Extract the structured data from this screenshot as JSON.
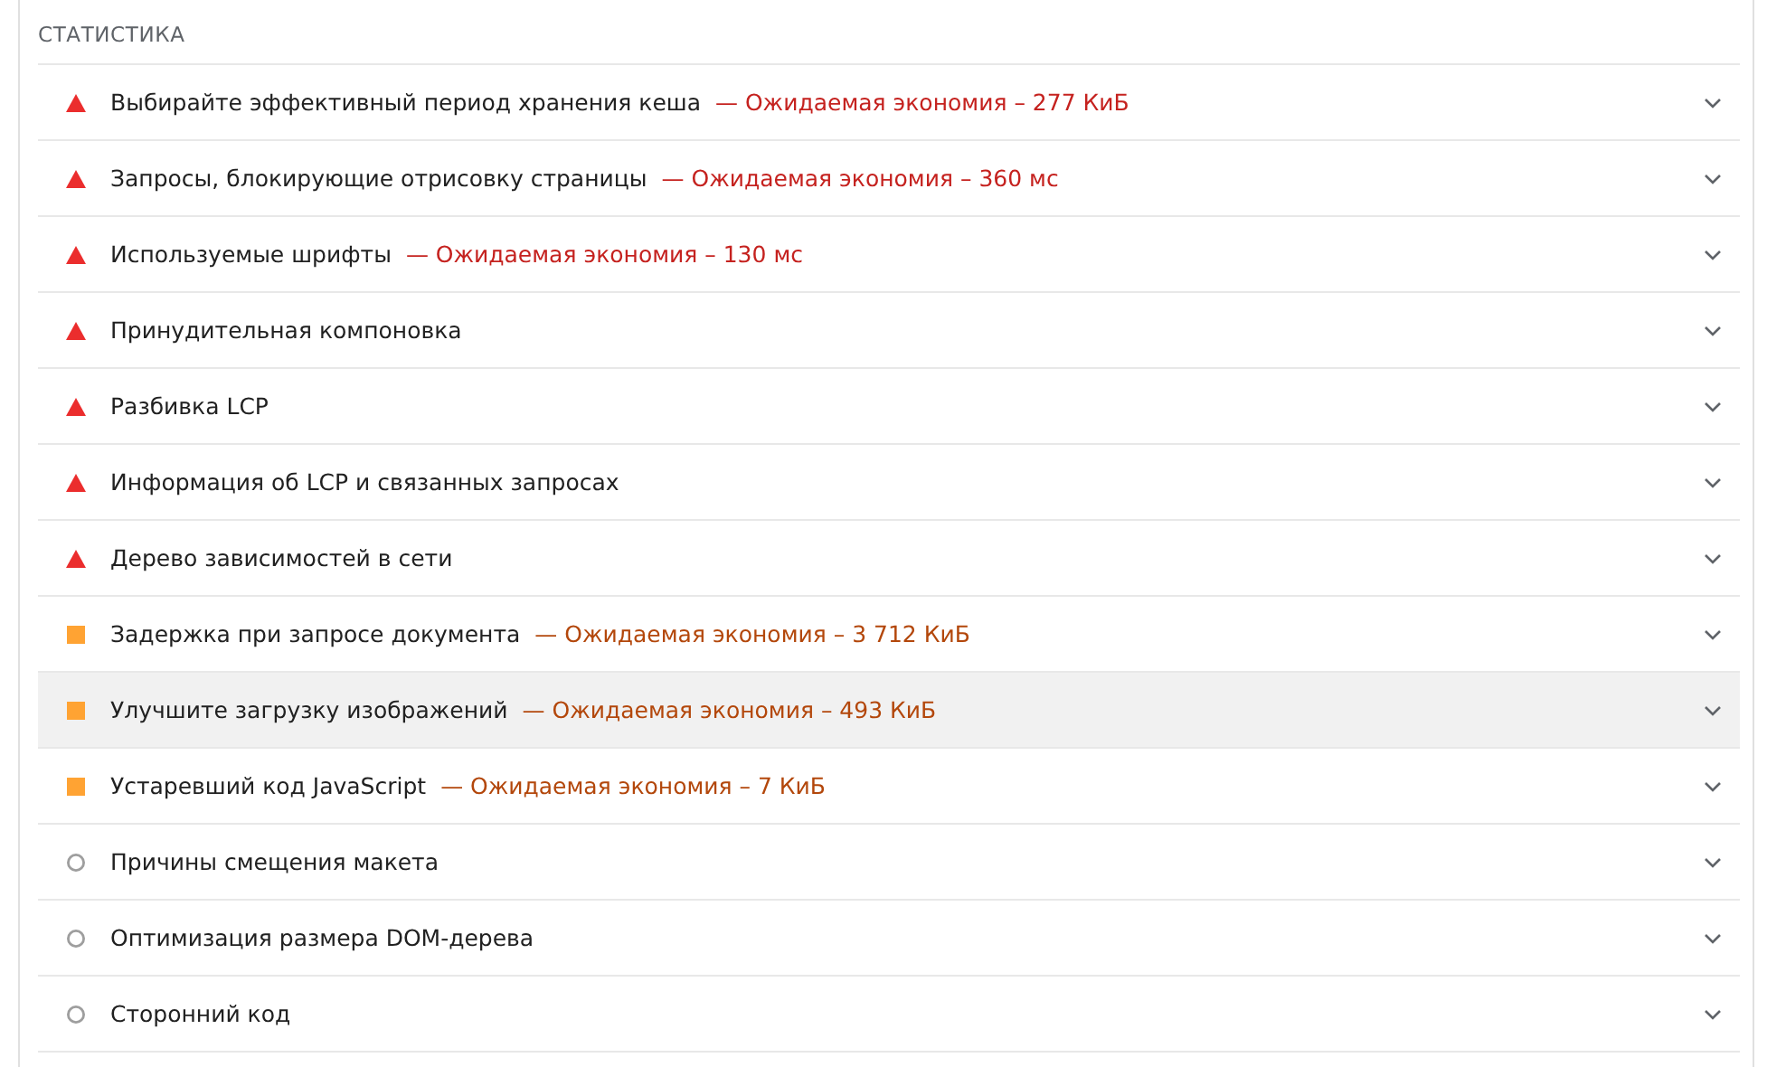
{
  "section": {
    "title": "СТАТИСТИКА"
  },
  "audits": [
    {
      "kind": "fail",
      "title": "Выбирайте эффективный период хранения кеша",
      "savings": "— Ожидаемая экономия – 277 КиБ",
      "hovered": false
    },
    {
      "kind": "fail",
      "title": "Запросы, блокирующие отрисовку страницы",
      "savings": "— Ожидаемая экономия – 360 мс",
      "hovered": false
    },
    {
      "kind": "fail",
      "title": "Используемые шрифты",
      "savings": "— Ожидаемая экономия – 130 мс",
      "hovered": false
    },
    {
      "kind": "fail",
      "title": "Принудительная компоновка",
      "hovered": false
    },
    {
      "kind": "fail",
      "title": "Разбивка LCP",
      "hovered": false
    },
    {
      "kind": "fail",
      "title": "Информация об LCP и связанных запросах",
      "hovered": false
    },
    {
      "kind": "fail",
      "title": "Дерево зависимостей в сети",
      "hovered": false
    },
    {
      "kind": "average",
      "title": "Задержка при запросе документа",
      "savings": "— Ожидаемая экономия – 3 712 КиБ",
      "hovered": false
    },
    {
      "kind": "average",
      "title": "Улучшите загрузку изображений",
      "savings": "— Ожидаемая экономия – 493 КиБ",
      "hovered": true
    },
    {
      "kind": "average",
      "title": "Устаревший код JavaScript",
      "savings": "— Ожидаемая экономия – 7 КиБ",
      "hovered": false
    },
    {
      "kind": "info",
      "title": "Причины смещения макета",
      "hovered": false
    },
    {
      "kind": "info",
      "title": "Оптимизация размера DOM-дерева",
      "hovered": false
    },
    {
      "kind": "info",
      "title": "Сторонний код",
      "hovered": false
    }
  ]
}
